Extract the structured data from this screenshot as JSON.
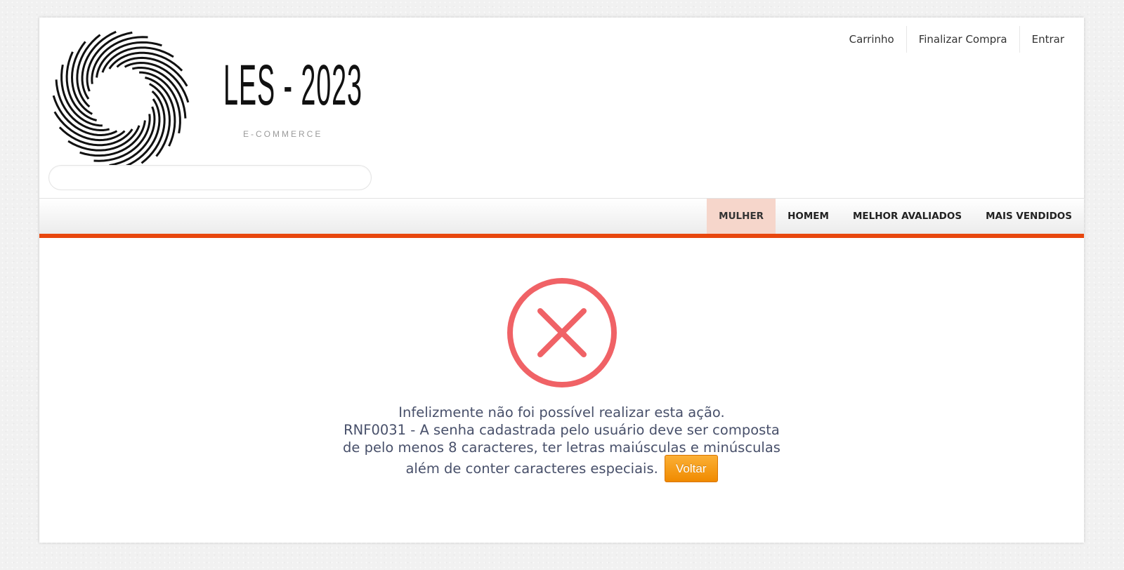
{
  "header": {
    "brand_title": "LES - 2023",
    "brand_subtitle": "E-COMMERCE",
    "search": {
      "value": "",
      "placeholder": ""
    },
    "top_links": [
      "Carrinho",
      "Finalizar Compra",
      "Entrar"
    ]
  },
  "nav": {
    "items": [
      "MULHER",
      "HOMEM",
      "MELHOR AVALIADOS",
      "MAIS VENDIDOS"
    ],
    "active": "MULHER"
  },
  "message": {
    "icon": "error-x-circle-icon",
    "line1": "Infelizmente não foi possível realizar esta ação.",
    "line2": "RNF0031 - A senha cadastrada pelo usuário deve ser composta",
    "line3": "de pelo menos 8 caracteres, ter letras maiúsculas e minúsculas",
    "line4": "além de conter caracteres especiais.",
    "button_label": "Voltar"
  },
  "colors": {
    "accent": "#e8470e",
    "error_icon": "#f06266",
    "button": "#f39c12",
    "active_nav_bg": "#f6d6cb"
  }
}
